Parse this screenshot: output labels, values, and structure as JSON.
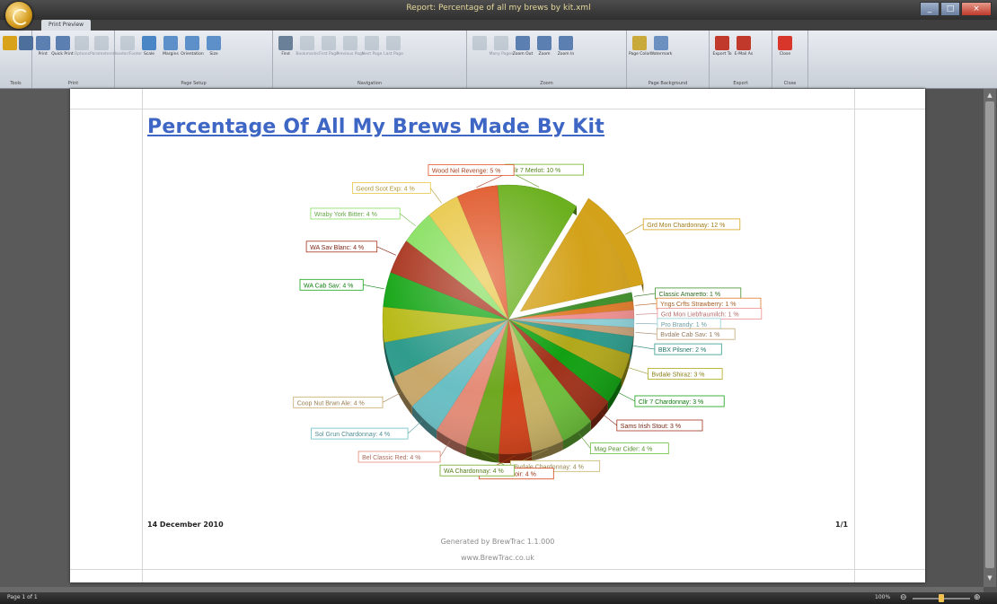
{
  "window": {
    "title": "Report: Percentage of all my brews by kit.xml"
  },
  "tab": {
    "label": "Print Preview"
  },
  "ribbon": {
    "groups": [
      {
        "label": "Tools",
        "items": [
          {
            "label": "",
            "disabled": false,
            "color": "#d9a21b"
          },
          {
            "label": "",
            "disabled": false,
            "color": "#4d6f9c"
          }
        ]
      },
      {
        "label": "Print",
        "items": [
          {
            "label": "Print",
            "disabled": false,
            "color": "#5b7fb0"
          },
          {
            "label": "Quick Print",
            "disabled": false,
            "color": "#5b7fb0"
          },
          {
            "label": "Options",
            "disabled": true,
            "color": "#8899aa"
          },
          {
            "label": "Parameters",
            "disabled": true,
            "color": "#8899aa"
          }
        ]
      },
      {
        "label": "Page Setup",
        "items": [
          {
            "label": "Header/Footer",
            "disabled": true,
            "color": "#8899aa"
          },
          {
            "label": "Scale",
            "disabled": false,
            "color": "#4a86c6"
          },
          {
            "label": "Margins",
            "disabled": false,
            "color": "#5d8fc8"
          },
          {
            "label": "Orientation",
            "disabled": false,
            "color": "#5d8fc8"
          },
          {
            "label": "Size",
            "disabled": false,
            "color": "#5d8fc8"
          }
        ]
      },
      {
        "label": "Navigation",
        "items": [
          {
            "label": "Find",
            "disabled": false,
            "color": "#6a7f98"
          },
          {
            "label": "Bookmarks",
            "disabled": true,
            "color": "#8899aa"
          },
          {
            "label": "First Page",
            "disabled": true,
            "color": "#8899aa"
          },
          {
            "label": "Previous Page",
            "disabled": true,
            "color": "#8899aa"
          },
          {
            "label": "Next Page",
            "disabled": true,
            "color": "#8899aa"
          },
          {
            "label": "Last Page",
            "disabled": true,
            "color": "#8899aa"
          }
        ]
      },
      {
        "label": "Zoom",
        "items": [
          {
            "label": "",
            "disabled": true,
            "color": "#8899aa"
          },
          {
            "label": "Many Pages",
            "disabled": true,
            "color": "#8899aa"
          },
          {
            "label": "Zoom Out",
            "disabled": false,
            "color": "#5b7fb0"
          },
          {
            "label": "Zoom",
            "disabled": false,
            "color": "#5b7fb0"
          },
          {
            "label": "Zoom In",
            "disabled": false,
            "color": "#5b7fb0"
          }
        ]
      },
      {
        "label": "Page Background",
        "items": [
          {
            "label": "Page Color",
            "disabled": false,
            "color": "#c9a93a"
          },
          {
            "label": "Watermark",
            "disabled": false,
            "color": "#6c90c0"
          }
        ]
      },
      {
        "label": "Export",
        "items": [
          {
            "label": "Export To",
            "disabled": false,
            "color": "#c0392b"
          },
          {
            "label": "E-Mail As",
            "disabled": false,
            "color": "#c0392b"
          }
        ]
      },
      {
        "label": "Close",
        "items": [
          {
            "label": "Close",
            "disabled": false,
            "color": "#d9362b"
          }
        ]
      }
    ]
  },
  "report": {
    "title": "Percentage Of All My Brews Made By Kit",
    "date": "14 December 2010",
    "page_number": "1/1",
    "generated_by": "Generated by BrewTrac 1.1.000",
    "website": "www.BrewTrac.co.uk"
  },
  "chart_data": {
    "type": "pie",
    "title": "",
    "exploded": [
      "Grd Mon Chardonnay"
    ],
    "slices": [
      {
        "label": "Cllr 7 Merlot: 10 %",
        "value": 10,
        "color": "#6bb01e"
      },
      {
        "label": "Grd Mon Chardonnay: 12 %",
        "value": 12,
        "color": "#d4a21a"
      },
      {
        "label": "Classic Amaretto: 1 %",
        "value": 1,
        "color": "#3f8f2a"
      },
      {
        "label": "Yngs Crfts Strawberry: 1 %",
        "value": 1,
        "color": "#e07b2a"
      },
      {
        "label": "Grd Mon Liebfraumilch: 1 %",
        "value": 1,
        "color": "#ef8f8f"
      },
      {
        "label": "Pro Brandy: 1 %",
        "value": 1,
        "color": "#8ed0d8"
      },
      {
        "label": "Bvdale Cab Sav: 1 %",
        "value": 1,
        "color": "#c6a27a"
      },
      {
        "label": "BBX Pilsner: 2 %",
        "value": 2,
        "color": "#2c9a8a"
      },
      {
        "label": "Bvdale Shiraz: 3 %",
        "value": 3,
        "color": "#b2a81a"
      },
      {
        "label": "Cllr 7 Chardonnay: 3 %",
        "value": 3,
        "color": "#12a012"
      },
      {
        "label": "Sams Irish Stout: 3 %",
        "value": 3,
        "color": "#a0321a"
      },
      {
        "label": "Mag Pear Cider: 4 %",
        "value": 4,
        "color": "#6cbf3a"
      },
      {
        "label": "Bvdale Chardonnay: 4 %",
        "value": 4,
        "color": "#c9b264"
      },
      {
        "label": "WA Pinot Noir: 4 %",
        "value": 4,
        "color": "#d4431a"
      },
      {
        "label": "WA Chardonnay: 4 %",
        "value": 4,
        "color": "#6ea820"
      },
      {
        "label": "Bel Classic Red: 4 %",
        "value": 4,
        "color": "#e48c78"
      },
      {
        "label": "Sol Grun Chardonnay: 4 %",
        "value": 4,
        "color": "#69bfc4"
      },
      {
        "label": "Coop Nut Brwn Ale: 4 %",
        "value": 4,
        "color": "#c9a86a"
      },
      {
        "label": "",
        "value": 4,
        "color": "#2f9c8c"
      },
      {
        "label": "",
        "value": 4,
        "color": "#b8ba18"
      },
      {
        "label": "WA Cab Sav: 4 %",
        "value": 4,
        "color": "#17a617"
      },
      {
        "label": "WA Sav Blanc: 4 %",
        "value": 4,
        "color": "#a8331c"
      },
      {
        "label": "Wraby York Bitter: 4 %",
        "value": 4,
        "color": "#86df5e"
      },
      {
        "label": "Geord Scot Exp: 4 %",
        "value": 4,
        "color": "#e8c746"
      },
      {
        "label": "Wood Nel Revenge: 5 %",
        "value": 5,
        "color": "#e0582a"
      }
    ]
  },
  "status": {
    "page": "Page 1 of 1",
    "zoom": "100%"
  }
}
